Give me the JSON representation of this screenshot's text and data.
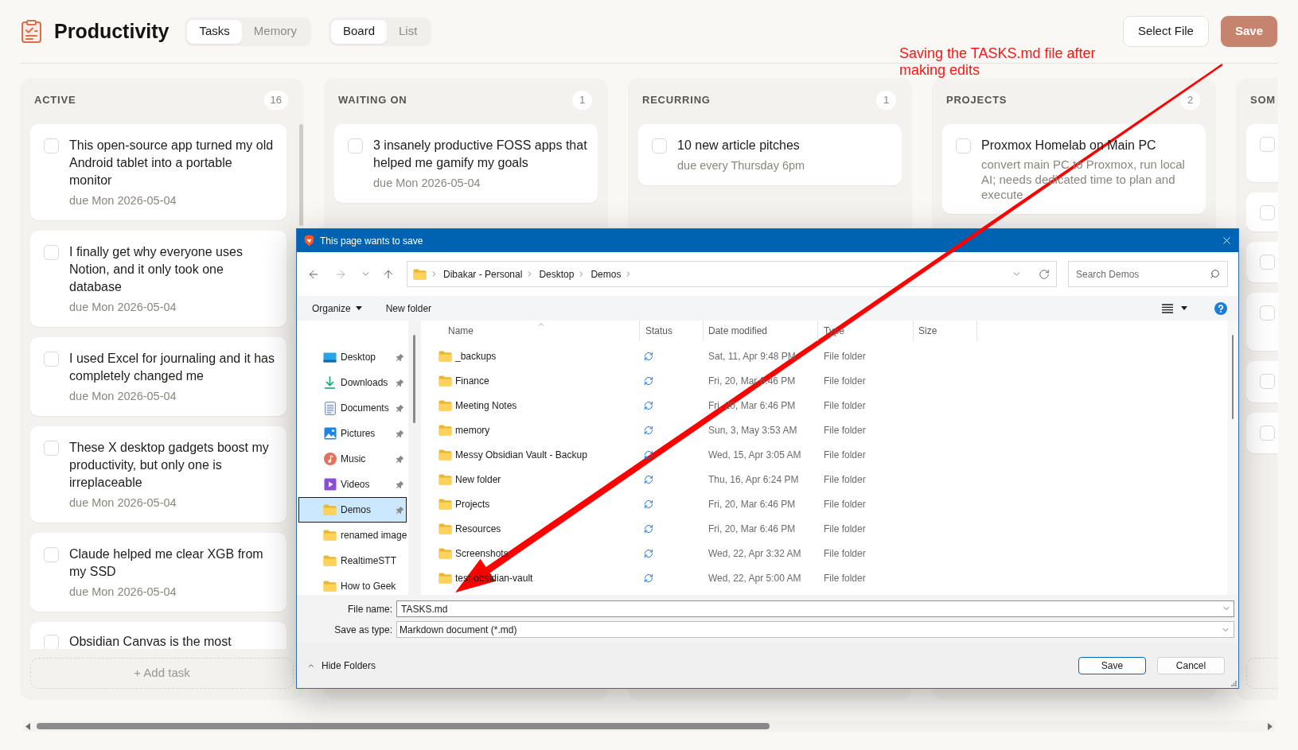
{
  "app_title": "Productivity",
  "section_tabs": [
    {
      "label": "Tasks",
      "selected": true
    },
    {
      "label": "Memory",
      "selected": false
    }
  ],
  "view_tabs": [
    {
      "label": "Board",
      "selected": true
    },
    {
      "label": "List",
      "selected": false
    }
  ],
  "actions": [
    {
      "label": "Select File",
      "kind": "secondary",
      "disabled": false
    },
    {
      "label": "Save",
      "kind": "primary",
      "disabled": true
    }
  ],
  "annotation": {
    "text": "Saving the TASKS.md file after making edits"
  },
  "columns": [
    {
      "title": "ACTIVE",
      "count": "16",
      "cards": [
        {
          "title": "This open-source app turned my old Android tablet into a portable monitor",
          "due": "due Mon 2026-05-04",
          "checked": false
        },
        {
          "title": "I finally get why everyone uses Notion, and it only took one database",
          "due": "due Mon 2026-05-04",
          "checked": false
        },
        {
          "title": "I used Excel for journaling and it has completely changed me",
          "due": "due Mon 2026-05-04",
          "checked": false
        },
        {
          "title": "These X desktop gadgets boost my productivity, but only one is irreplaceable",
          "due": "due Mon 2026-05-04",
          "checked": false
        },
        {
          "title": "Claude helped me clear XGB from my SSD",
          "due": "due Mon 2026-05-04",
          "checked": false
        },
        {
          "title": "Obsidian Canvas is the most",
          "checked": false,
          "cut_off": true
        }
      ],
      "add_task": {
        "shown": true,
        "label": "+ Add task"
      }
    },
    {
      "title": "WAITING ON",
      "count": "1",
      "cards": [
        {
          "title": "3 insanely productive FOSS apps that helped me gamify my goals",
          "due": "due Mon 2026-05-04",
          "checked": false
        }
      ]
    },
    {
      "title": "RECURRING",
      "count": "1",
      "cards": [
        {
          "title": "10 new article pitches",
          "due": "due every Thursday 6pm",
          "checked": false
        }
      ]
    },
    {
      "title": "PROJECTS",
      "count": "2",
      "cards": [
        {
          "title": "Proxmox Homelab on Main PC",
          "note": "convert main PC to Proxmox, run local AI; needs dedicated time to plan and execute",
          "checked": false
        }
      ]
    },
    {
      "title": "SOM",
      "cards": [
        {
          "checked": false
        },
        {
          "checked": false
        },
        {
          "checked": false
        },
        {
          "checked": false
        },
        {
          "checked": false
        },
        {
          "checked": false
        }
      ],
      "add_task": {
        "shown": true
      }
    }
  ],
  "save_dialog": {
    "title": "This page wants to save",
    "nav_buttons": [
      {
        "kind": "back",
        "disabled": false
      },
      {
        "kind": "forward",
        "disabled": true
      },
      {
        "kind": "recent",
        "disabled": false
      },
      {
        "kind": "up",
        "disabled": false
      }
    ],
    "path": [
      "Dibakar - Personal",
      "Desktop",
      "Demos"
    ],
    "search_placeholder": "Search Demos",
    "toolbar": [
      {
        "label": "Organize",
        "kind": "menu"
      },
      {
        "label": "New folder",
        "kind": "action"
      }
    ],
    "nav_items": [
      {
        "label": "Desktop",
        "kind": "desktop",
        "pinned": true,
        "selected": false
      },
      {
        "label": "Downloads",
        "kind": "downloads",
        "pinned": true,
        "selected": false
      },
      {
        "label": "Documents",
        "kind": "documents",
        "pinned": true,
        "selected": false
      },
      {
        "label": "Pictures",
        "kind": "pictures",
        "pinned": true,
        "selected": false
      },
      {
        "label": "Music",
        "kind": "music",
        "pinned": true,
        "selected": false
      },
      {
        "label": "Videos",
        "kind": "videos",
        "pinned": true,
        "selected": false
      },
      {
        "label": "Demos",
        "kind": "folder",
        "pinned": true,
        "selected": true
      },
      {
        "label": "renamed image",
        "kind": "folder",
        "pinned": false,
        "selected": false
      },
      {
        "label": "RealtimeSTT",
        "kind": "folder",
        "pinned": false,
        "selected": false
      },
      {
        "label": "How to Geek",
        "kind": "folder",
        "pinned": false,
        "selected": false
      }
    ],
    "columns": [
      "Name",
      "Status",
      "Date modified",
      "Type",
      "Size"
    ],
    "files": [
      {
        "name": "_backups",
        "date_modified": "Sat, 11, Apr 9:48 PM",
        "type": "File folder"
      },
      {
        "name": "Finance",
        "date_modified": "Fri, 20, Mar 6:46 PM",
        "type": "File folder"
      },
      {
        "name": "Meeting Notes",
        "date_modified": "Fri, 20, Mar 6:46 PM",
        "type": "File folder"
      },
      {
        "name": "memory",
        "date_modified": "Sun, 3, May 3:53 AM",
        "type": "File folder"
      },
      {
        "name": "Messy Obsidian Vault - Backup",
        "date_modified": "Wed, 15, Apr 3:05 AM",
        "type": "File folder"
      },
      {
        "name": "New folder",
        "date_modified": "Thu, 16, Apr 6:24 PM",
        "type": "File folder"
      },
      {
        "name": "Projects",
        "date_modified": "Fri, 20, Mar 6:46 PM",
        "type": "File folder"
      },
      {
        "name": "Resources",
        "date_modified": "Fri, 20, Mar 6:46 PM",
        "type": "File folder"
      },
      {
        "name": "Screenshots",
        "date_modified": "Wed, 22, Apr 3:32 AM",
        "type": "File folder"
      },
      {
        "name": "test-obsidian-vault",
        "date_modified": "Wed, 22, Apr 5:00 AM",
        "type": "File folder"
      }
    ],
    "file_name_label": "File name:",
    "file_name": "TASKS.md",
    "type_label": "Save as type:",
    "save_type": "Markdown document (*.md)",
    "hide_folders": "Hide Folders",
    "buttons": [
      {
        "label": "Save",
        "kind": "primary"
      },
      {
        "label": "Cancel",
        "kind": "secondary"
      }
    ]
  }
}
